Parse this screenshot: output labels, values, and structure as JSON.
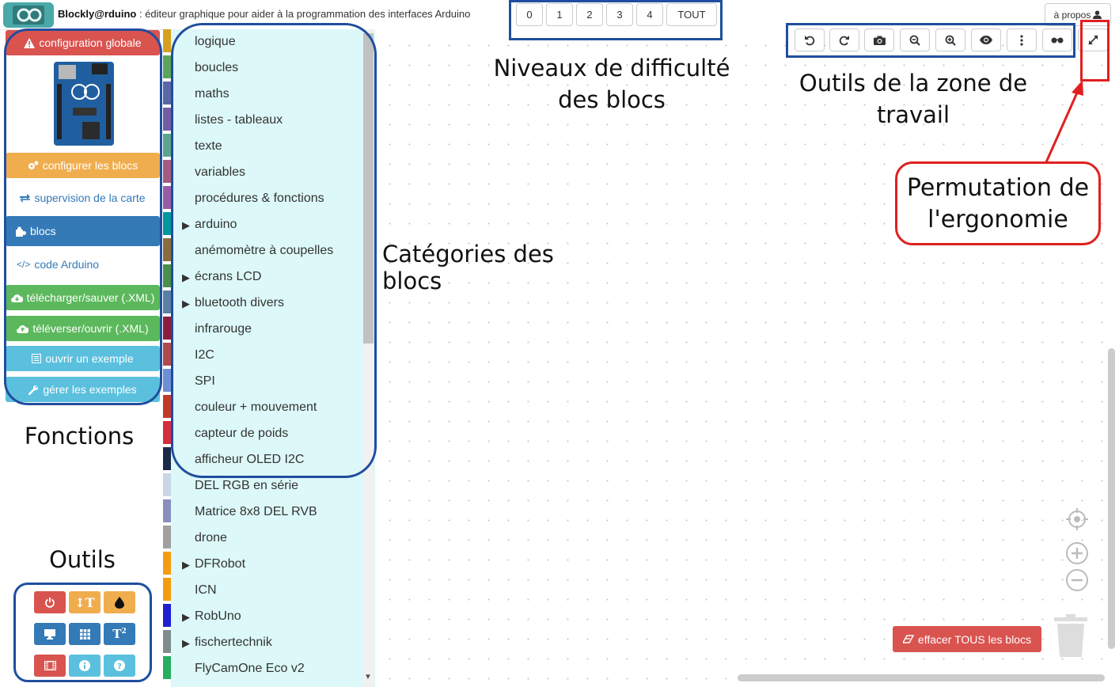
{
  "header": {
    "app_name": "Blockly@rduino",
    "subtitle": " : éditeur graphique pour aider à la programmation des interfaces Arduino",
    "levels": [
      "0",
      "1",
      "2",
      "3",
      "4",
      "TOUT"
    ],
    "about_label": "à propos"
  },
  "sidebar": {
    "global_config": "configuration globale",
    "configure_blocks": "configurer les blocs",
    "board_supervision": "supervision de la carte",
    "blocks": "blocs",
    "arduino_code": "code Arduino",
    "download_save": "télécharger/sauver (.XML)",
    "upload_open": "téléverser/ouvrir (.XML)",
    "open_example": "ouvrir un exemple",
    "manage_examples": "gérer les exemples",
    "tools": [
      {
        "icon": "power-icon",
        "color": "#d9534f"
      },
      {
        "icon": "text-size-icon",
        "color": "#f0ad4e"
      },
      {
        "icon": "drop-icon",
        "color": "#f0ad4e"
      },
      {
        "icon": "monitor-icon",
        "color": "#337ab7"
      },
      {
        "icon": "grid-icon",
        "color": "#337ab7"
      },
      {
        "icon": "superscript-icon",
        "color": "#337ab7"
      },
      {
        "icon": "film-icon",
        "color": "#d9534f"
      },
      {
        "icon": "info-icon",
        "color": "#5bc0de"
      },
      {
        "icon": "help-icon",
        "color": "#5bc0de"
      }
    ]
  },
  "toolbox": {
    "categories": [
      {
        "label": "logique",
        "expandable": false,
        "color": "#d6a01f"
      },
      {
        "label": "boucles",
        "expandable": false,
        "color": "#5ba55b"
      },
      {
        "label": "maths",
        "expandable": false,
        "color": "#5b67a5"
      },
      {
        "label": "listes - tableaux",
        "expandable": false,
        "color": "#745ba5"
      },
      {
        "label": "texte",
        "expandable": false,
        "color": "#5ba58c"
      },
      {
        "label": "variables",
        "expandable": false,
        "color": "#a55b80"
      },
      {
        "label": "procédures & fonctions",
        "expandable": false,
        "color": "#995ba5"
      },
      {
        "label": "arduino",
        "expandable": true,
        "color": "#00979d"
      },
      {
        "label": "anémomètre à coupelles",
        "expandable": false,
        "color": "#8a6d3b"
      },
      {
        "label": "écrans LCD",
        "expandable": true,
        "color": "#4a8f4a"
      },
      {
        "label": "bluetooth divers",
        "expandable": true,
        "color": "#5b80a5"
      },
      {
        "label": "infrarouge",
        "expandable": false,
        "color": "#8c1c3c"
      },
      {
        "label": "I2C",
        "expandable": false,
        "color": "#b04a4a"
      },
      {
        "label": "SPI",
        "expandable": false,
        "color": "#6d8fd6"
      },
      {
        "label": "couleur + mouvement",
        "expandable": false,
        "color": "#c0392b"
      },
      {
        "label": "capteur de poids",
        "expandable": false,
        "color": "#d62d40"
      },
      {
        "label": "afficheur OLED I2C",
        "expandable": false,
        "color": "#1a2a4a"
      },
      {
        "label": "DEL RGB en série",
        "expandable": false,
        "color": "#c8d6e5"
      },
      {
        "label": "Matrice 8x8 DEL RVB",
        "expandable": false,
        "color": "#8a8fc0"
      },
      {
        "label": "drone",
        "expandable": false,
        "color": "#a0a0a0"
      },
      {
        "label": "DFRobot",
        "expandable": true,
        "color": "#f39c12"
      },
      {
        "label": "ICN",
        "expandable": false,
        "color": "#f39c12"
      },
      {
        "label": "RobUno",
        "expandable": true,
        "color": "#2020d0"
      },
      {
        "label": "fischertechnik",
        "expandable": true,
        "color": "#7f8c8d"
      },
      {
        "label": "FlyCamOne Eco v2",
        "expandable": false,
        "color": "#27ae60"
      }
    ]
  },
  "workspace_tools": [
    "undo-icon",
    "redo-icon",
    "camera-icon",
    "zoom-out-icon",
    "zoom-in-icon",
    "eye-icon",
    "more-icon",
    "glasses-icon",
    "expand-icon"
  ],
  "clear_all_label": "effacer TOUS les blocs",
  "annotations": {
    "levels": [
      "Niveaux de difficulté",
      "des blocs"
    ],
    "workspace_tools": [
      "Outils de la zone de",
      "travail"
    ],
    "permutation": [
      "Permutation de",
      "l'ergonomie"
    ],
    "categories": "Catégories des blocs",
    "functions": "Fonctions",
    "tools": "Outils"
  }
}
